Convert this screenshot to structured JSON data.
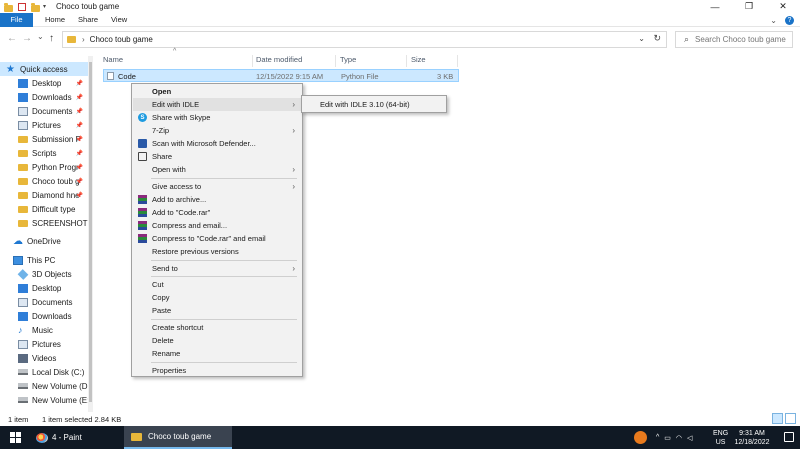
{
  "window": {
    "title": "Choco toub game",
    "controls": [
      "—",
      "❐",
      "✕"
    ]
  },
  "ribbon": {
    "tabs": [
      "File",
      "Home",
      "Share",
      "View"
    ],
    "right_icons": [
      "chevron-down-icon",
      "help-icon"
    ]
  },
  "navigation": {
    "back": "←",
    "forward": "→",
    "recent": "⌄",
    "up": "↑",
    "breadcrumb_separator": "›",
    "breadcrumb": "Choco toub game",
    "search_placeholder": "Search Choco toub game"
  },
  "sidebar": {
    "items": [
      {
        "label": "Quick access",
        "icon": "star-icon",
        "pinned": false,
        "active": true
      },
      {
        "label": "Desktop",
        "icon": "desktop-icon",
        "pinned": true
      },
      {
        "label": "Downloads",
        "icon": "downloads-icon",
        "pinned": true
      },
      {
        "label": "Documents",
        "icon": "documents-icon",
        "pinned": true
      },
      {
        "label": "Pictures",
        "icon": "pictures-icon",
        "pinned": true
      },
      {
        "label": "Submission P",
        "icon": "folder-icon",
        "pinned": true
      },
      {
        "label": "Scripts",
        "icon": "folder-icon",
        "pinned": true
      },
      {
        "label": "Python Progr",
        "icon": "folder-icon",
        "pinned": true
      },
      {
        "label": "Choco toub g",
        "icon": "folder-icon",
        "pinned": true
      },
      {
        "label": "Diamond hne",
        "icon": "folder-icon",
        "pinned": true
      },
      {
        "label": "Difficult type",
        "icon": "folder-icon",
        "pinned": false
      },
      {
        "label": "SCREENSHOTS",
        "icon": "folder-icon",
        "pinned": false
      },
      {
        "label": "OneDrive",
        "icon": "cloud-icon",
        "pinned": false
      },
      {
        "label": "This PC",
        "icon": "pc-icon",
        "pinned": false
      },
      {
        "label": "3D Objects",
        "icon": "3d-objects-icon",
        "pinned": false
      },
      {
        "label": "Desktop",
        "icon": "desktop-icon",
        "pinned": false
      },
      {
        "label": "Documents",
        "icon": "documents-icon",
        "pinned": false
      },
      {
        "label": "Downloads",
        "icon": "downloads-icon",
        "pinned": false
      },
      {
        "label": "Music",
        "icon": "music-icon",
        "pinned": false
      },
      {
        "label": "Pictures",
        "icon": "pictures-icon",
        "pinned": false
      },
      {
        "label": "Videos",
        "icon": "videos-icon",
        "pinned": false
      },
      {
        "label": "Local Disk (C:)",
        "icon": "disk-icon",
        "pinned": false
      },
      {
        "label": "New Volume (D:",
        "icon": "disk-icon",
        "pinned": false
      },
      {
        "label": "New Volume (E:)",
        "icon": "disk-icon",
        "pinned": false
      }
    ]
  },
  "file_list": {
    "columns": [
      "Name",
      "Date modified",
      "Type",
      "Size"
    ],
    "rows": [
      {
        "name": "Code",
        "date": "12/15/2022 9:15 AM",
        "type": "Python File",
        "size": "3 KB"
      }
    ]
  },
  "context_menu": {
    "items": [
      {
        "label": "Open",
        "bold": true
      },
      {
        "label": "Edit with IDLE",
        "submenu": true
      },
      {
        "label": "Share with Skype",
        "icon": "skype-icon"
      },
      {
        "label": "7-Zip",
        "submenu": true
      },
      {
        "label": "Scan with Microsoft Defender...",
        "icon": "defender-icon"
      },
      {
        "label": "Share",
        "icon": "share-icon"
      },
      {
        "label": "Open with",
        "submenu": true
      },
      {
        "label": "Give access to",
        "submenu": true
      },
      {
        "label": "Add to archive...",
        "icon": "winrar-icon"
      },
      {
        "label": "Add to \"Code.rar\"",
        "icon": "winrar-icon"
      },
      {
        "label": "Compress and email...",
        "icon": "winrar-icon"
      },
      {
        "label": "Compress to \"Code.rar\" and email",
        "icon": "winrar-icon"
      },
      {
        "label": "Restore previous versions"
      },
      {
        "label": "Send to",
        "submenu": true
      },
      {
        "label": "Cut"
      },
      {
        "label": "Copy"
      },
      {
        "label": "Paste"
      },
      {
        "label": "Create shortcut"
      },
      {
        "label": "Delete"
      },
      {
        "label": "Rename"
      },
      {
        "label": "Properties"
      }
    ],
    "submenu_arrow": "›",
    "submenu": {
      "label": "Edit with IDLE 3.10 (64-bit)"
    }
  },
  "status": {
    "count": "1 item",
    "selected": "1 item selected  2.84 KB"
  },
  "taskbar": {
    "apps": [
      {
        "label": "4 - Paint",
        "icon": "paint-icon",
        "active": false
      },
      {
        "label": "Choco toub game",
        "icon": "folder-icon",
        "active": true
      }
    ],
    "tray": {
      "chevron": "^",
      "language": "ENG",
      "region": "US",
      "time": "9:31 AM",
      "date": "12/18/2022"
    }
  },
  "colors": {
    "accent": "#1a73c8",
    "selection": "#cce8ff",
    "taskbar": "#101924",
    "folder": "#e8b73a"
  }
}
